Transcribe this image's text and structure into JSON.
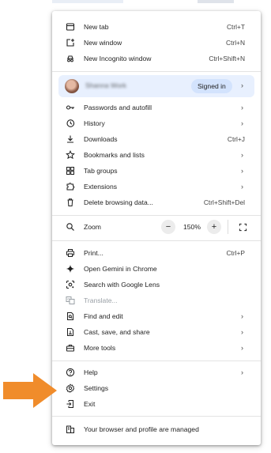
{
  "colors": {
    "accent_bg": "#e8f0fe",
    "signed_in_bg": "#d3e3fd",
    "arrow": "#f08c2b"
  },
  "menu": {
    "new_tab": {
      "label": "New tab",
      "shortcut": "Ctrl+T",
      "icon": "new-tab-icon"
    },
    "new_window": {
      "label": "New window",
      "shortcut": "Ctrl+N",
      "icon": "new-window-icon"
    },
    "new_incognito": {
      "label": "New Incognito window",
      "shortcut": "Ctrl+Shift+N",
      "icon": "incognito-icon"
    },
    "profile": {
      "name": "Shanna Work",
      "status": "Signed in"
    },
    "passwords": {
      "label": "Passwords and autofill",
      "icon": "key-icon"
    },
    "history": {
      "label": "History",
      "icon": "history-icon"
    },
    "downloads": {
      "label": "Downloads",
      "shortcut": "Ctrl+J",
      "icon": "download-icon"
    },
    "bookmarks": {
      "label": "Bookmarks and lists",
      "icon": "star-icon"
    },
    "tab_groups": {
      "label": "Tab groups",
      "icon": "tab-groups-icon"
    },
    "extensions": {
      "label": "Extensions",
      "icon": "puzzle-icon"
    },
    "delete_data": {
      "label": "Delete browsing data...",
      "shortcut": "Ctrl+Shift+Del",
      "icon": "trash-icon"
    },
    "zoom": {
      "label": "Zoom",
      "minus": "−",
      "value": "150%",
      "plus": "+",
      "icon": "zoom-icon"
    },
    "print": {
      "label": "Print...",
      "shortcut": "Ctrl+P",
      "icon": "printer-icon"
    },
    "gemini": {
      "label": "Open Gemini in Chrome",
      "icon": "gemini-icon"
    },
    "lens": {
      "label": "Search with Google Lens",
      "icon": "lens-icon"
    },
    "translate": {
      "label": "Translate...",
      "icon": "translate-icon"
    },
    "find_edit": {
      "label": "Find and edit",
      "icon": "find-icon"
    },
    "cast": {
      "label": "Cast, save, and share",
      "icon": "cast-icon"
    },
    "more_tools": {
      "label": "More tools",
      "icon": "toolbox-icon"
    },
    "help": {
      "label": "Help",
      "icon": "help-icon"
    },
    "settings": {
      "label": "Settings",
      "icon": "gear-icon"
    },
    "exit": {
      "label": "Exit",
      "icon": "exit-icon"
    },
    "managed": {
      "label": "Your browser and profile are managed",
      "icon": "managed-icon"
    }
  }
}
